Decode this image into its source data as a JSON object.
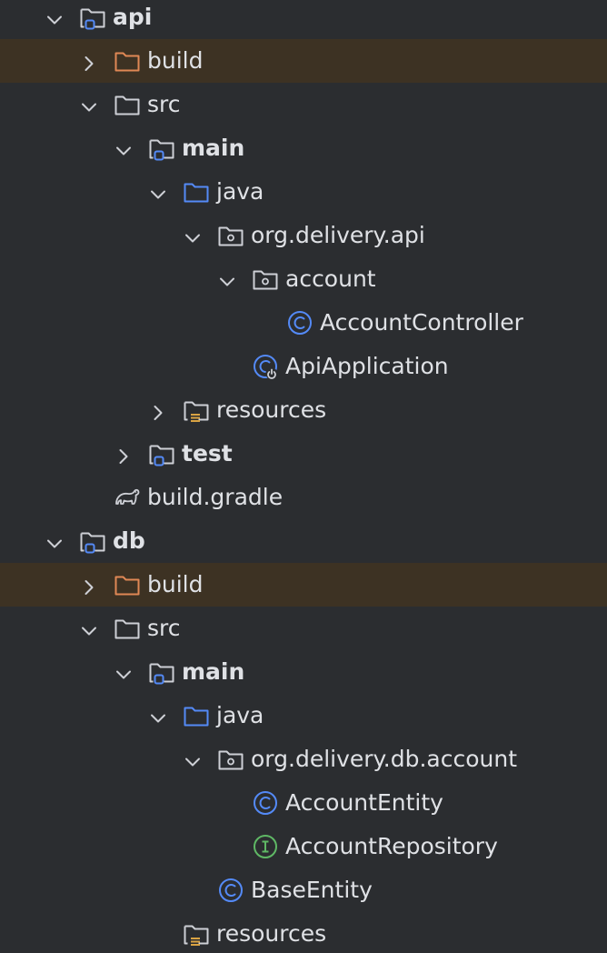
{
  "colors": {
    "background": "#2b2d30",
    "excluded_row": "#3d3223",
    "text": "#dfe1e5",
    "folder_icon": "#ced0d6",
    "module_badge": "#548af7",
    "source_folder": "#548af7",
    "excluded_folder": "#e08855",
    "class_icon": "#548af7",
    "interface_icon": "#5fb865",
    "resources_badge": "#d9a343"
  },
  "tree": [
    {
      "label": "api",
      "icon": "module-folder-icon",
      "expanded": true,
      "bold": true,
      "depth": 1,
      "excluded": false
    },
    {
      "label": "build",
      "icon": "excluded-folder-icon",
      "expanded": false,
      "bold": false,
      "depth": 2,
      "excluded": true
    },
    {
      "label": "src",
      "icon": "folder-icon",
      "expanded": true,
      "bold": false,
      "depth": 2,
      "excluded": false
    },
    {
      "label": "main",
      "icon": "module-folder-icon",
      "expanded": true,
      "bold": true,
      "depth": 3,
      "excluded": false
    },
    {
      "label": "java",
      "icon": "source-folder-icon",
      "expanded": true,
      "bold": false,
      "depth": 4,
      "excluded": false
    },
    {
      "label": "org.delivery.api",
      "icon": "package-icon",
      "expanded": true,
      "bold": false,
      "depth": 5,
      "excluded": false
    },
    {
      "label": "account",
      "icon": "package-icon",
      "expanded": true,
      "bold": false,
      "depth": 6,
      "excluded": false
    },
    {
      "label": "AccountController",
      "icon": "class-icon",
      "expanded": null,
      "bold": false,
      "depth": 7,
      "excluded": false
    },
    {
      "label": "ApiApplication",
      "icon": "spring-boot-class-icon",
      "expanded": null,
      "bold": false,
      "depth": 6,
      "excluded": false
    },
    {
      "label": "resources",
      "icon": "resources-folder-icon",
      "expanded": false,
      "bold": false,
      "depth": 4,
      "excluded": false
    },
    {
      "label": "test",
      "icon": "module-folder-icon",
      "expanded": false,
      "bold": true,
      "depth": 3,
      "excluded": false
    },
    {
      "label": "build.gradle",
      "icon": "gradle-icon",
      "expanded": null,
      "bold": false,
      "depth": 2,
      "excluded": false
    },
    {
      "label": "db",
      "icon": "module-folder-icon",
      "expanded": true,
      "bold": true,
      "depth": 1,
      "excluded": false
    },
    {
      "label": "build",
      "icon": "excluded-folder-icon",
      "expanded": false,
      "bold": false,
      "depth": 2,
      "excluded": true
    },
    {
      "label": "src",
      "icon": "folder-icon",
      "expanded": true,
      "bold": false,
      "depth": 2,
      "excluded": false
    },
    {
      "label": "main",
      "icon": "module-folder-icon",
      "expanded": true,
      "bold": true,
      "depth": 3,
      "excluded": false
    },
    {
      "label": "java",
      "icon": "source-folder-icon",
      "expanded": true,
      "bold": false,
      "depth": 4,
      "excluded": false
    },
    {
      "label": "org.delivery.db.account",
      "icon": "package-icon",
      "expanded": true,
      "bold": false,
      "depth": 5,
      "excluded": false
    },
    {
      "label": "AccountEntity",
      "icon": "class-icon",
      "expanded": null,
      "bold": false,
      "depth": 6,
      "excluded": false
    },
    {
      "label": "AccountRepository",
      "icon": "interface-icon",
      "expanded": null,
      "bold": false,
      "depth": 6,
      "excluded": false
    },
    {
      "label": "BaseEntity",
      "icon": "class-icon",
      "expanded": null,
      "bold": false,
      "depth": 5,
      "excluded": false
    },
    {
      "label": "resources",
      "icon": "resources-folder-icon",
      "expanded": null,
      "bold": false,
      "depth": 4,
      "excluded": false
    }
  ]
}
